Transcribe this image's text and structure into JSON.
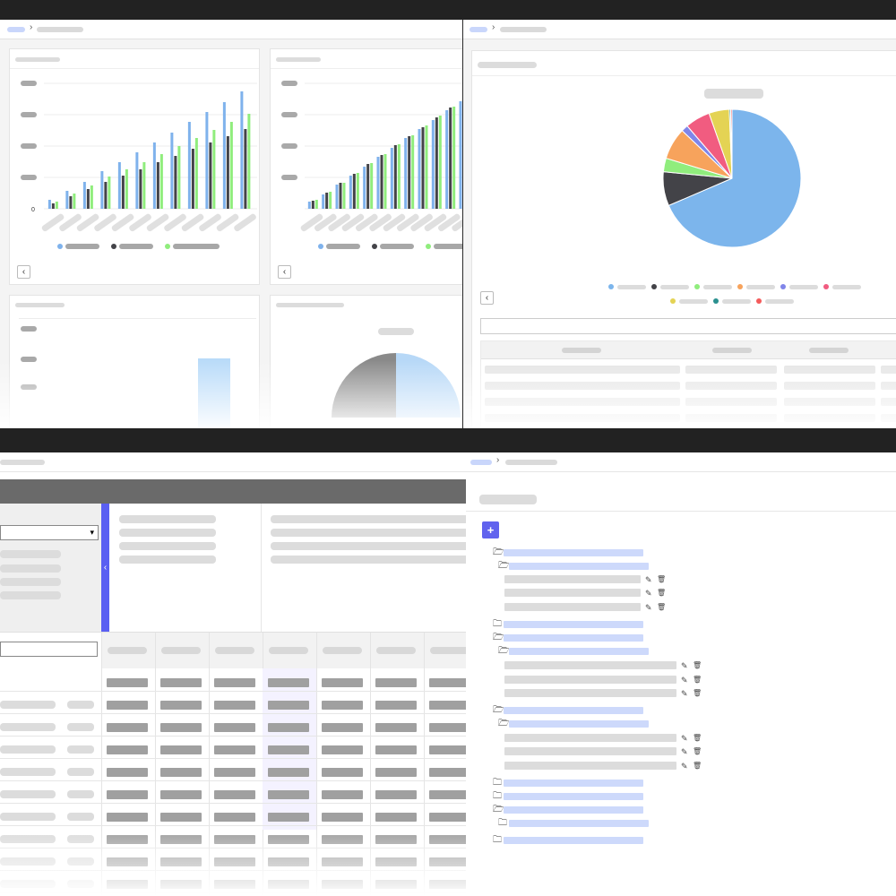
{
  "screens": {
    "analytics_dashboard": {
      "breadcrumb": {
        "separator": "›"
      },
      "bar_chart_1": {
        "y_zero_label": "0",
        "pager_prev": "‹",
        "colors": [
          "#7fb2ec",
          "#434348",
          "#90ed7d"
        ]
      },
      "bar_chart_2": {
        "pager_prev": "‹"
      }
    },
    "pie_report": {
      "breadcrumb": {
        "separator": "›"
      },
      "pager_prev": "‹",
      "colors": [
        "#7cb5ec",
        "#434348",
        "#90ed7d",
        "#f7a35c",
        "#8085e9",
        "#f15c80",
        "#e4d354",
        "#2b908f",
        "#f45b5b"
      ]
    },
    "data_grid": {
      "sidebar_toggle": "‹",
      "select_caret": "▾"
    },
    "tree_manager": {
      "breadcrumb": {
        "separator": "›"
      },
      "add_button": "+",
      "edit_icon": "✎",
      "delete_icon": "🗑",
      "folder_open_icon": "🗁",
      "folder_closed_icon": "🗀"
    }
  },
  "chart_data": [
    {
      "type": "bar",
      "categories": [
        "",
        "",
        "",
        "",
        "",
        "",
        "",
        "",
        "",
        "",
        "",
        ""
      ],
      "series": [
        {
          "values": [
            10,
            20,
            30,
            42,
            52,
            63,
            74,
            85,
            97,
            108,
            119,
            131
          ]
        },
        {
          "values": [
            6,
            14,
            22,
            30,
            37,
            44,
            52,
            59,
            67,
            74,
            81,
            89
          ]
        },
        {
          "values": [
            8,
            17,
            26,
            36,
            44,
            52,
            61,
            70,
            79,
            88,
            97,
            106
          ]
        }
      ],
      "ylim": [
        0,
        140
      ],
      "grid": true,
      "legend": "bottom"
    },
    {
      "type": "bar",
      "categories": [
        "",
        "",
        "",
        "",
        "",
        "",
        "",
        "",
        "",
        "",
        "",
        ""
      ],
      "series": [
        {
          "values": [
            8,
            16,
            27,
            37,
            47,
            58,
            68,
            79,
            89,
            99,
            110,
            120
          ]
        },
        {
          "values": [
            9,
            18,
            29,
            39,
            50,
            60,
            71,
            81,
            91,
            102,
            113,
            121
          ]
        },
        {
          "values": [
            10,
            19,
            29,
            40,
            51,
            61,
            72,
            82,
            93,
            104,
            114,
            117
          ]
        }
      ],
      "ylim": [
        0,
        140
      ],
      "grid": true,
      "legend": "bottom"
    },
    {
      "type": "pie",
      "values": [
        64.5,
        7.5,
        3.0,
        7.0,
        1.5,
        5.5,
        4.5,
        0.3,
        0.3
      ],
      "legend": "bottom"
    }
  ]
}
